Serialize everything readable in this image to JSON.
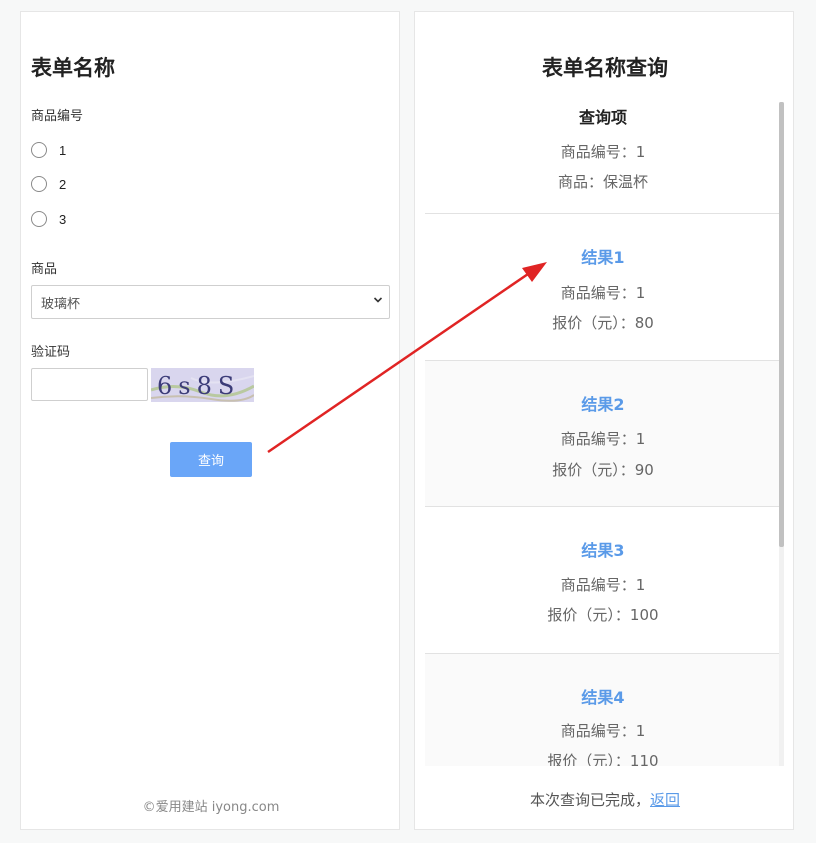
{
  "form": {
    "title": "表单名称",
    "product_no_label": "商品编号",
    "radio_options": [
      "1",
      "2",
      "3"
    ],
    "product_label": "商品",
    "product_selected": "玻璃杯",
    "captcha_label": "验证码",
    "captcha_value": "",
    "captcha_text": "6s8S",
    "submit_label": "查询",
    "copyright": "©爱用建站 iyong.com"
  },
  "results": {
    "title": "表单名称查询",
    "query": {
      "heading": "查询项",
      "product_no": "商品编号：1",
      "product": "商品：保温杯"
    },
    "items": [
      {
        "heading": "结果1",
        "product_no": "商品编号：1",
        "price": "报价（元）：80"
      },
      {
        "heading": "结果2",
        "product_no": "商品编号：1",
        "price": "报价（元）：90"
      },
      {
        "heading": "结果3",
        "product_no": "商品编号：1",
        "price": "报价（元）：100"
      },
      {
        "heading": "结果4",
        "product_no": "商品编号：1",
        "price": "报价（元）：110"
      }
    ],
    "footer_text": "本次查询已完成，",
    "back_link": "返回"
  },
  "colors": {
    "accent": "#6aa6f8",
    "link": "#5a9ae8",
    "annotation_arrow": "#e02424"
  },
  "icons": {
    "select_caret": "chevron-down-icon",
    "arrow": "arrow-icon"
  }
}
